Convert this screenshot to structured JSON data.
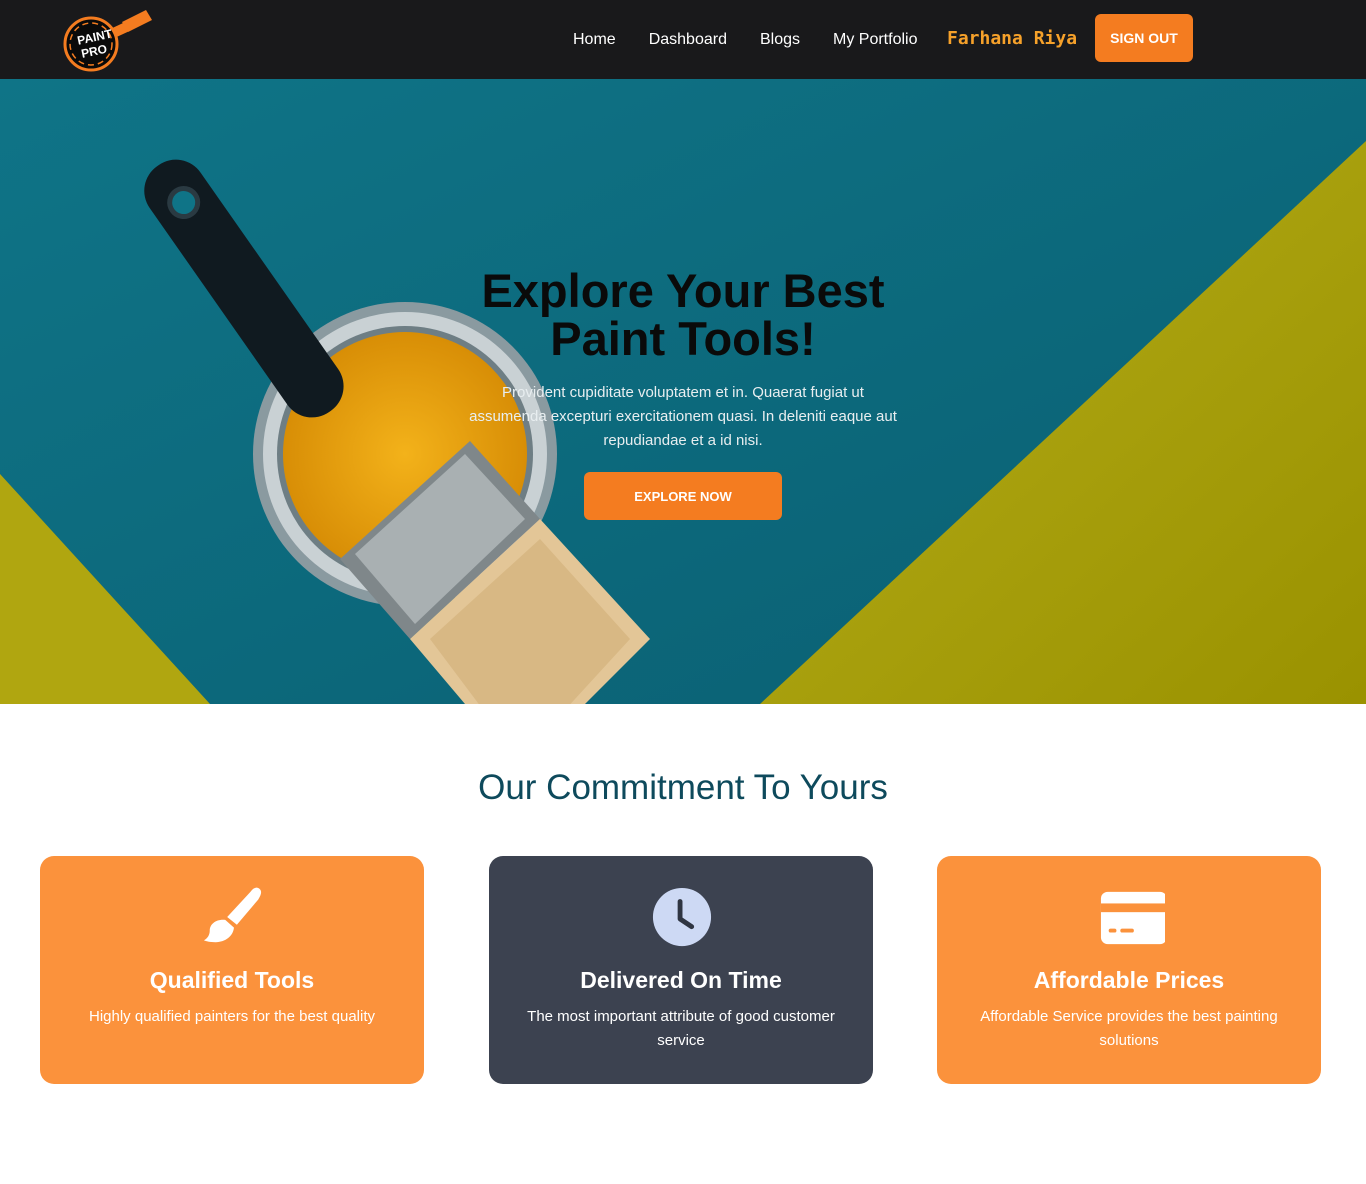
{
  "brand": {
    "logo_line1": "PAINT",
    "logo_line2": "PRO",
    "colors": {
      "accent": "#f47c20",
      "nav_bg": "#19191b",
      "user": "#f6a12a"
    }
  },
  "nav": {
    "links": [
      "Home",
      "Dashboard",
      "Blogs",
      "My Portfolio"
    ],
    "user_name": "Farhana Riya",
    "signout_label": "SIGN OUT"
  },
  "hero": {
    "title_line1": "Explore Your Best",
    "title_line2": "Paint Tools!",
    "text": "Provident cupiditate voluptatem et in. Quaerat fugiat ut assumenda excepturi exercitationem quasi. In deleniti eaque aut repudiandae et a id nisi.",
    "button_label": "EXPLORE NOW"
  },
  "commitment": {
    "title": "Our Commitment To Yours",
    "cards": [
      {
        "icon": "paintbrush-icon",
        "title": "Qualified Tools",
        "text": "Highly qualified painters for the best quality",
        "color": "#fb923c"
      },
      {
        "icon": "clock-icon",
        "title": "Delivered On Time",
        "text": "The most important attribute of good customer service",
        "color": "#3c4250"
      },
      {
        "icon": "credit-card-icon",
        "title": "Affordable Prices",
        "text": "Affordable Service provides the best painting solutions",
        "color": "#fb923c"
      }
    ]
  }
}
